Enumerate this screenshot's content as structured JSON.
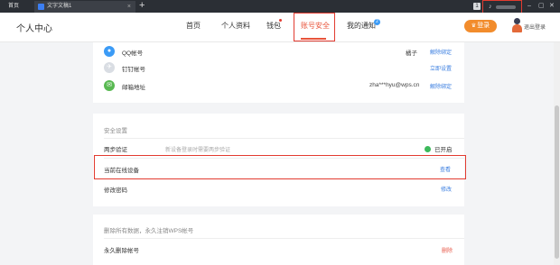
{
  "titlebar": {
    "home_tab": "首页",
    "doc_tab": "文字文稿1",
    "tab_close": "×",
    "new_tab": "+",
    "badge": "1",
    "controls": [
      "–",
      "▢",
      "✕"
    ]
  },
  "header": {
    "title": "个人中心",
    "nav": [
      "首页",
      "个人资料",
      "钱包",
      "账号安全",
      "我的通知"
    ],
    "notice_count": "2",
    "vip_button": "登录",
    "vip_icon": "♛",
    "logout": "退出登录"
  },
  "bindings": {
    "qq": {
      "label": "QQ帐号",
      "value": "橘子",
      "action": "解除绑定"
    },
    "dingtalk": {
      "label": "钉钉帐号",
      "action": "立即设置"
    },
    "email": {
      "label": "邮箱地址",
      "value": "zha***hyu@wps.cn",
      "action": "解除绑定"
    }
  },
  "security": {
    "section_title": "安全设置",
    "two_step_label": "两步验证",
    "two_step_desc": "新设备登录时需要两步验证",
    "two_step_status": "已开启",
    "devices_label": "当前在线设备",
    "devices_action": "查看",
    "password_label": "修改密码",
    "password_action": "修改"
  },
  "danger": {
    "section_title": "删除所有数据，永久注销WPS帐号",
    "delete_label": "永久删除帐号",
    "delete_action": "删除"
  },
  "colors": {
    "accent": "#3a7ee0",
    "highlight_border": "#e23b30",
    "vip": "#f28c2c",
    "status_on": "#3cb95b",
    "qq_icon": "#3b9bf6",
    "dingtalk_icon": "#d9dde3",
    "email_icon": "#59b952"
  }
}
